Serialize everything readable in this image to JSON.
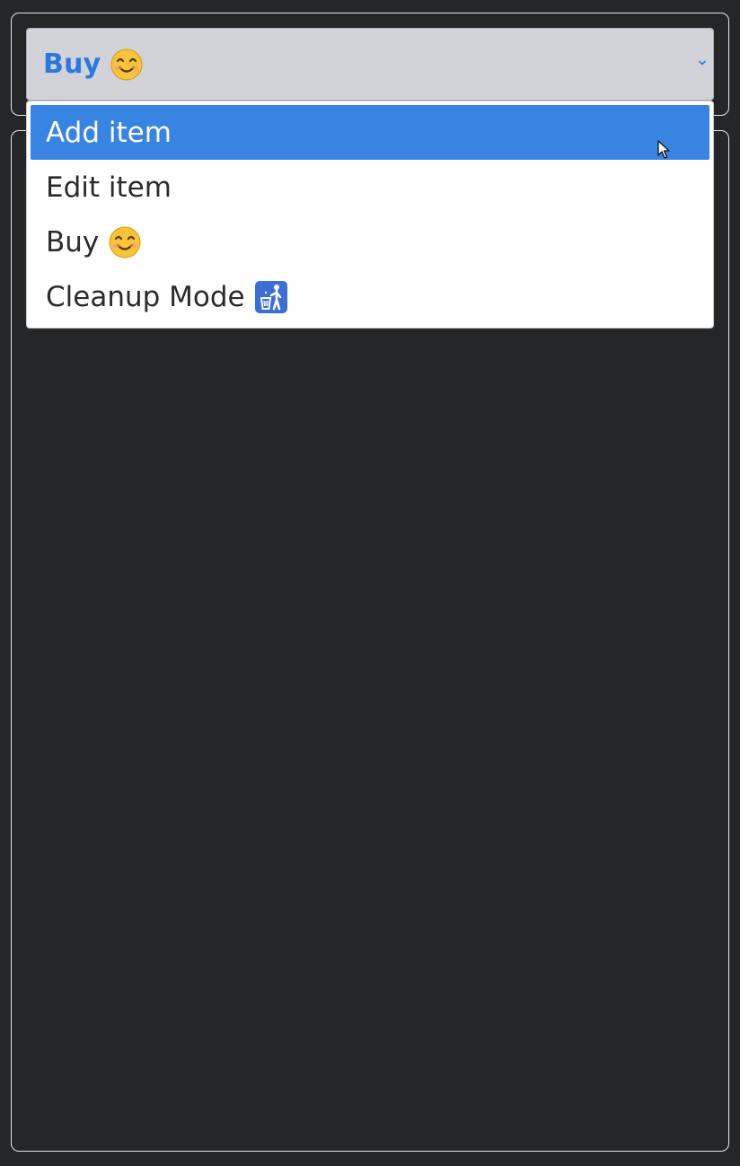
{
  "mode_select": {
    "selected_label": "Buy",
    "selected_emoji": "smiling-face-icon",
    "options": [
      {
        "label": "Add item",
        "icon": ""
      },
      {
        "label": "Edit item",
        "icon": ""
      },
      {
        "label": "Buy",
        "icon": "smiling-face-icon"
      },
      {
        "label": "Cleanup Mode",
        "icon": "litter-in-bin-icon"
      }
    ],
    "highlighted_option": "Add item"
  },
  "colors": {
    "page_bg": "#252628",
    "select_bg": "#d1d3d8",
    "select_text": "#2a78e0",
    "highlight": "#3784e2",
    "panel_border": "#e6e6e6"
  }
}
